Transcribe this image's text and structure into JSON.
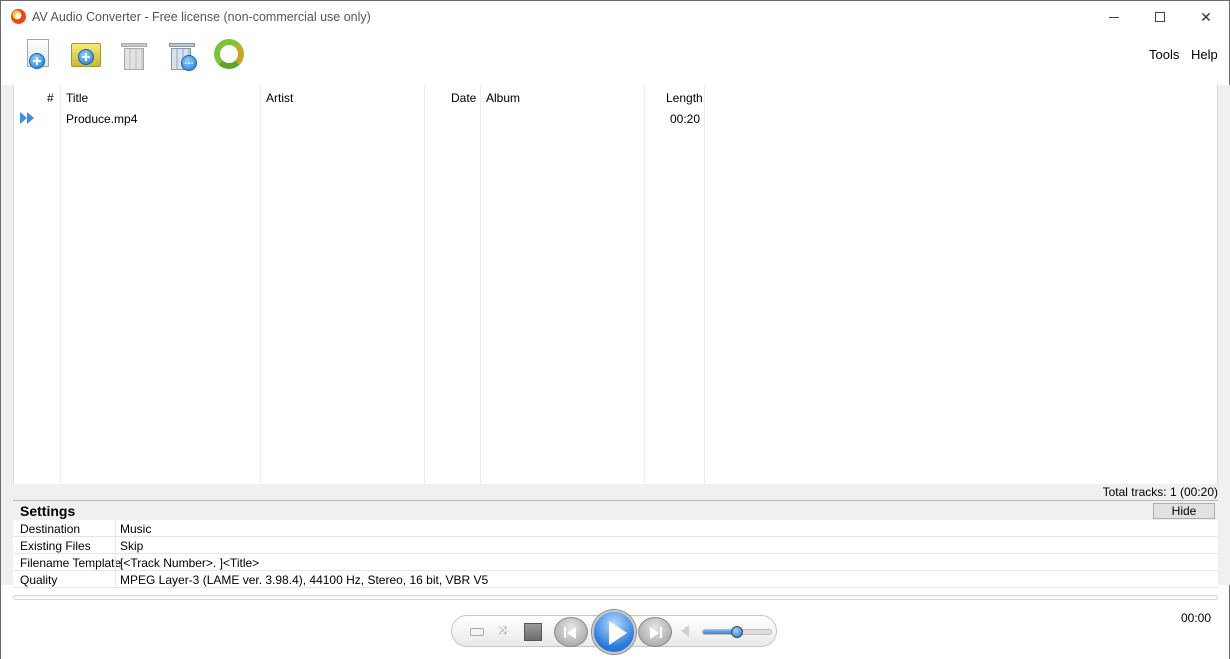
{
  "window": {
    "title": "AV Audio Converter - Free license (non-commercial use only)"
  },
  "toolbar": {
    "buttons": [
      {
        "name": "add-files",
        "icon": "add-file-icon"
      },
      {
        "name": "add-folder",
        "icon": "add-folder-icon"
      },
      {
        "name": "remove",
        "icon": "trash-icon"
      },
      {
        "name": "remove-more",
        "icon": "trash-more-icon"
      },
      {
        "name": "convert",
        "icon": "convert-icon"
      }
    ],
    "menu": {
      "tools": "Tools",
      "help": "Help"
    }
  },
  "track_list": {
    "columns": {
      "num": "#",
      "title": "Title",
      "artist": "Artist",
      "date": "Date",
      "album": "Album",
      "length": "Length"
    },
    "rows": [
      {
        "num": "",
        "title": "Produce.mp4",
        "artist": "",
        "date": "",
        "album": "",
        "length": "00:20",
        "state_icon": "playing-indicator-icon"
      }
    ],
    "total": "Total tracks: 1 (00:20)"
  },
  "settings": {
    "title": "Settings",
    "hide_label": "Hide",
    "rows": [
      {
        "label": "Destination",
        "value": "Music"
      },
      {
        "label": "Existing Files",
        "value": "Skip"
      },
      {
        "label": "Filename Template",
        "value": "[<Track Number>. ]<Title>"
      },
      {
        "label": "Quality",
        "value": "MPEG Layer-3 (LAME ver. 3.98.4), 44100 Hz, Stereo, 16 bit, VBR V5"
      }
    ]
  },
  "player": {
    "time": "00:00",
    "volume_level": 0.5,
    "accent": "#2677d9"
  }
}
